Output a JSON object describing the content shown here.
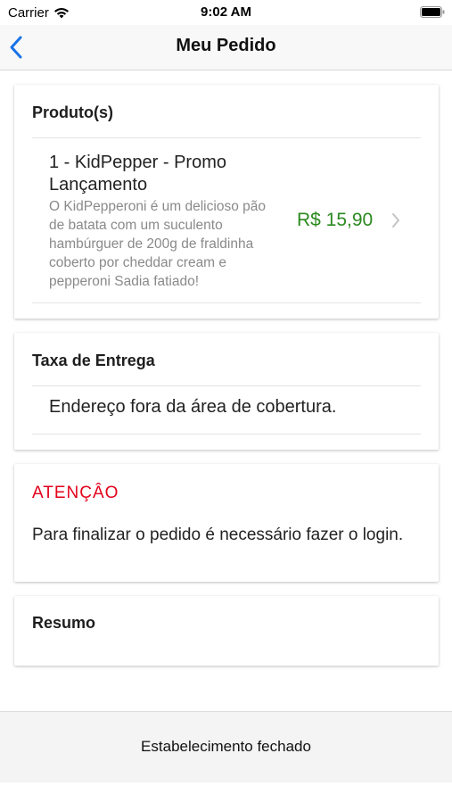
{
  "status_bar": {
    "carrier": "Carrier",
    "time": "9:02 AM"
  },
  "nav": {
    "title": "Meu Pedido"
  },
  "products_card": {
    "title": "Produto(s)",
    "item": {
      "name": "1 - KidPepper - Promo Lançamento",
      "description": "O KidPepperoni é um delicioso pão de batata com um suculento hambúrguer de 200g de fraldinha coberto por cheddar cream e pepperoni Sadia fatiado!",
      "price": "R$ 15,90"
    }
  },
  "delivery_card": {
    "title": "Taxa de Entrega",
    "message": "Endereço fora da área de cobertura."
  },
  "warning_card": {
    "title": "ATENÇÂO",
    "message": "Para finalizar o pedido é necessário fazer o login."
  },
  "summary_card": {
    "title": "Resumo"
  },
  "footer": {
    "label": "Estabelecimento fechado"
  },
  "colors": {
    "accent": "#1a73e8",
    "price": "#2a8a1f",
    "warning": "#e3001b"
  }
}
